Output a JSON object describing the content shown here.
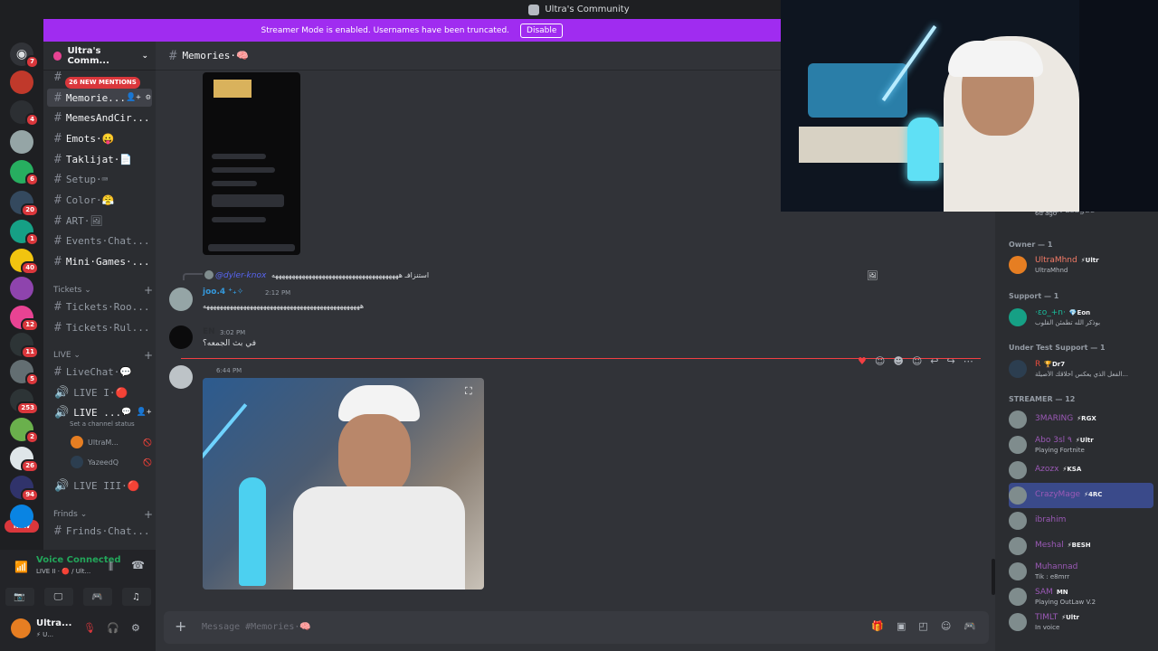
{
  "window": {
    "title": "Ultra's Community"
  },
  "banner": {
    "text": "Streamer Mode is enabled. Usernames have been truncated.",
    "button": "Disable"
  },
  "servers": [
    {
      "badge": "7",
      "color": "#5865f2"
    },
    {
      "badge": "",
      "color": "#c0392b"
    },
    {
      "badge": "4",
      "color": "#2c2f33"
    },
    {
      "badge": "",
      "color": "#95a5a6"
    },
    {
      "badge": "6",
      "color": "#27ae60"
    },
    {
      "badge": "20",
      "color": "#34495e"
    },
    {
      "badge": "1",
      "color": "#16a085"
    },
    {
      "badge": "40",
      "color": "#f1c40f"
    },
    {
      "badge": "",
      "color": "#8e44ad"
    },
    {
      "badge": "12",
      "color": "#e84393"
    },
    {
      "badge": "11",
      "color": "#2d3436"
    },
    {
      "badge": "5",
      "color": "#636e72"
    },
    {
      "badge": "253",
      "color": "#2d3436"
    },
    {
      "badge": "2",
      "color": "#6ab04c"
    },
    {
      "badge": "26",
      "color": "#dfe6e9"
    },
    {
      "badge": "94",
      "color": "#30336b"
    },
    {
      "badge": "",
      "color": "#0984e3"
    }
  ],
  "server_new": "NEW",
  "sidebar": {
    "server_name": "Ultra's Comm...",
    "mentions": "26 NEW MENTIONS",
    "channels_top": [
      {
        "name": "Memorie...",
        "active": true
      },
      {
        "name": "MemesAndCir...",
        "active": false
      },
      {
        "name": "Emots·😛",
        "active": false
      },
      {
        "name": "Taklijat·📄",
        "active": false
      },
      {
        "name": "Setup·⌨",
        "active": false
      },
      {
        "name": "Color·😤",
        "active": false
      },
      {
        "name": "ART·🖼",
        "active": false
      },
      {
        "name": "Events·Chat...",
        "active": false
      },
      {
        "name": "Mini·Games·...",
        "active": false
      }
    ],
    "cat_tickets": "Tickets",
    "tickets": [
      {
        "name": "Tickets·Roo..."
      },
      {
        "name": "Tickets·Rul..."
      }
    ],
    "cat_live": "LIVE",
    "live_chat": "LiveChat·💬",
    "live_1": "LIVE I·🔴",
    "live_2": "LIVE ...",
    "live_2_status": "Set a channel status",
    "voice_users": [
      {
        "name": "UltraM..."
      },
      {
        "name": "YazeedQ"
      }
    ],
    "live_3": "LIVE III·🔴",
    "cat_friends": "Frinds",
    "friends_chat": "Frinds·Chat..."
  },
  "voice": {
    "title": "Voice Connected",
    "sub": "LIVE II · 🔴 / Ult..."
  },
  "user": {
    "name": "Ultra...",
    "tag": "⚡ U..."
  },
  "chat": {
    "channel": "Memories·🧠",
    "reply_to": "@dyler-knox",
    "reply_text": "استنزافـ ههههههههههههههههههههههههههههههههههههههه",
    "msg1_name": "joo.4 ⁺₊✧",
    "msg1_time": "2:12 PM",
    "msg1_text": "هههههههههههههههههههههههههههههههههههههههههههههههه",
    "msg2_name": "EN",
    "msg2_time": "3:02 PM",
    "msg2_text": "في بث الجمعه؟",
    "msg3_time": "6:44 PM",
    "composer_placeholder": "Message #Memories·🧠"
  },
  "members": {
    "top_partial": {
      "name": "Rocket League",
      "status": "6d ago"
    },
    "owner_cat": "Owner — 1",
    "owner": {
      "name": "UltraMhnd",
      "role": "⚡Ultr",
      "status": "UltraMhnd",
      "color": "#f47b67"
    },
    "support_cat": "Support — 1",
    "support": {
      "name": "·ɛo_+n·",
      "role": "💎Eon",
      "status": "بوذكر الله تطمئن القلوب",
      "color": "#1abc9c"
    },
    "uts_cat": "Under Test Support — 1",
    "uts": {
      "name": "R",
      "role": "🏆Dr7",
      "status": "الفعل الذي يعكس أخلاقك الأصيلة...",
      "color": "#e74c3c"
    },
    "streamer_cat": "STREAMER — 12",
    "streamers": [
      {
        "name": "3MARING",
        "role": "⚡RGX",
        "status": "",
        "color": "#9b59b6"
      },
      {
        "name": "Abo 3sl ٩",
        "role": "⚡Ultr",
        "status": "Playing Fortnite",
        "color": "#9b59b6"
      },
      {
        "name": "Azozx",
        "role": "⚡KSA",
        "status": "",
        "color": "#9b59b6"
      },
      {
        "name": "CrazyMage",
        "role": "⚡4RC",
        "status": "",
        "color": "#9b59b6"
      },
      {
        "name": "ibrahim",
        "role": "",
        "status": "",
        "color": "#9b59b6"
      },
      {
        "name": "Meshal",
        "role": "⚡BESH",
        "status": "",
        "color": "#9b59b6"
      },
      {
        "name": "Muhannad",
        "role": "",
        "status": "Tik : e8mrr",
        "color": "#9b59b6"
      },
      {
        "name": "SAM",
        "role": "MN",
        "status": "Playing OutLaw V.2",
        "color": "#9b59b6"
      },
      {
        "name": "TIMLT",
        "role": "⚡Ultr",
        "status": "In voice",
        "color": "#9b59b6"
      }
    ]
  },
  "colors": {
    "accent": "#a02cf0",
    "danger": "#da373c",
    "online": "#23a55a"
  }
}
